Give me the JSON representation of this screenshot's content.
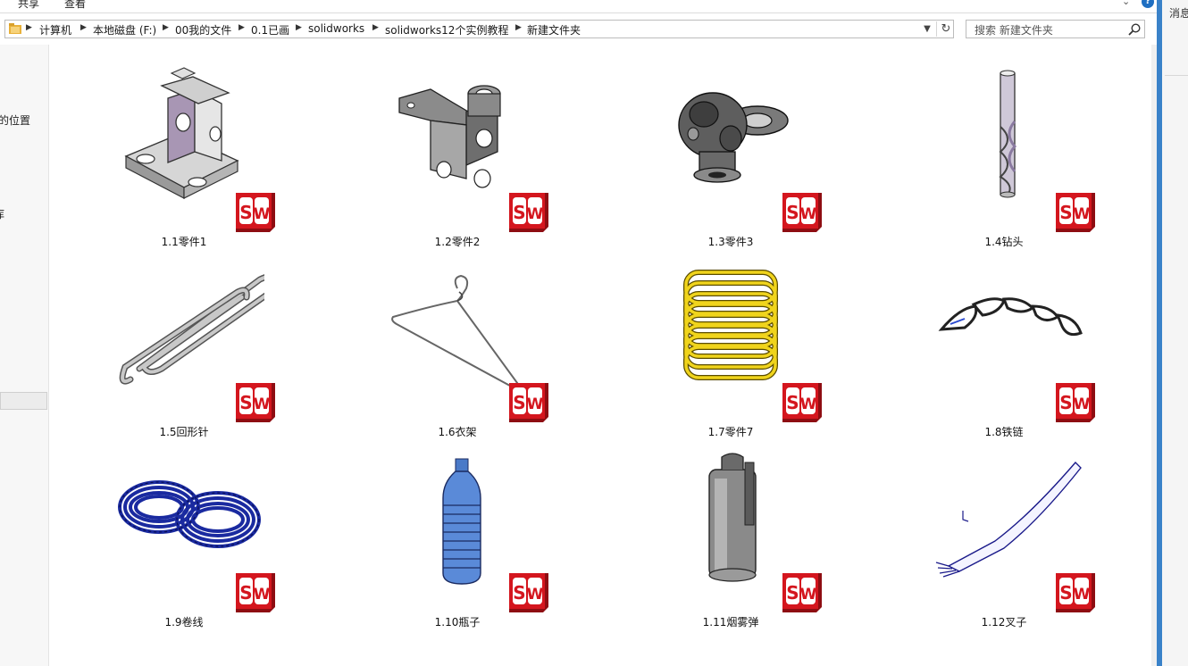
{
  "ribbon": {
    "tabs": [
      "共享",
      "查看"
    ],
    "help": "?"
  },
  "address": {
    "crumbs": [
      "计算机",
      "本地磁盘 (F:)",
      "00我的文件",
      "0.1已画",
      "solidworks",
      "solidworks12个实例教程",
      "新建文件夹"
    ]
  },
  "search": {
    "placeholder": "搜索 新建文件夹"
  },
  "nav": {
    "items": [
      "的位置",
      "库"
    ]
  },
  "right_panel": {
    "title": "消息"
  },
  "files": [
    {
      "name": "1.1零件1"
    },
    {
      "name": "1.2零件2"
    },
    {
      "name": "1.3零件3"
    },
    {
      "name": "1.4钻头"
    },
    {
      "name": "1.5回形针"
    },
    {
      "name": "1.6衣架"
    },
    {
      "name": "1.7零件7"
    },
    {
      "name": "1.8铁链"
    },
    {
      "name": "1.9卷线"
    },
    {
      "name": "1.10瓶子"
    },
    {
      "name": "1.11烟雾弹"
    },
    {
      "name": "1.12叉子"
    }
  ],
  "icons": {
    "badge": "solidworks-file-icon",
    "address": "folder-icon",
    "search": "search-icon",
    "refresh": "refresh-icon",
    "dropdown": "chevron-down-icon"
  },
  "colors": {
    "badge_red": "#d4161e",
    "accent": "#3a82c9",
    "coil_blue": "#1a2aa0",
    "spring_yellow": "#f0d41c"
  }
}
